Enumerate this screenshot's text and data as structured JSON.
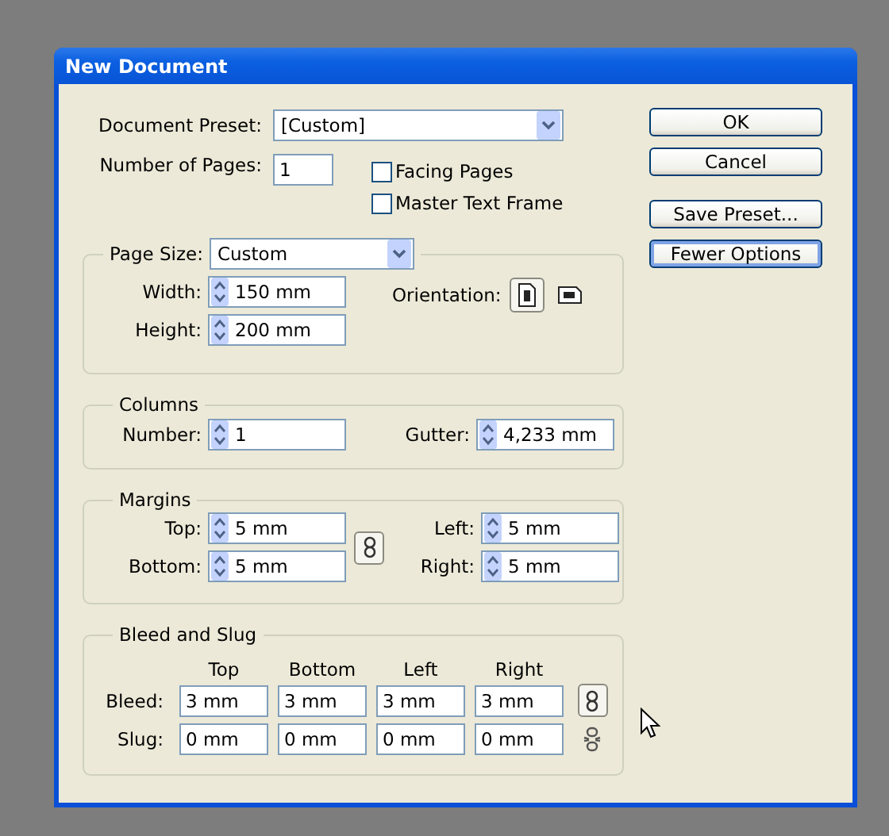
{
  "window": {
    "title": "New Document"
  },
  "document_preset": {
    "label": "Document Preset:",
    "value": "[Custom]"
  },
  "number_of_pages": {
    "label": "Number of Pages:",
    "value": "1"
  },
  "checkboxes": [
    {
      "label": "Facing Pages",
      "checked": false
    },
    {
      "label": "Master Text Frame",
      "checked": false
    }
  ],
  "page_size": {
    "label": "Page Size:",
    "value": "Custom",
    "fields": [
      {
        "label": "Width:",
        "value": "150 mm"
      },
      {
        "label": "Height:",
        "value": "200 mm"
      }
    ],
    "orientation": {
      "label": "Orientation:",
      "options": [
        {
          "kind": "portrait",
          "selected": true
        },
        {
          "kind": "landscape",
          "selected": false
        }
      ]
    }
  },
  "columns": {
    "title": "Columns",
    "fields": [
      {
        "label": "Number:",
        "value": "1"
      },
      {
        "label": "Gutter:",
        "value": "4,233 mm"
      }
    ]
  },
  "margins": {
    "title": "Margins",
    "linked": true,
    "fields": [
      {
        "label": "Top:",
        "value": "5 mm"
      },
      {
        "label": "Left:",
        "value": "5 mm"
      },
      {
        "label": "Bottom:",
        "value": "5 mm"
      },
      {
        "label": "Right:",
        "value": "5 mm"
      }
    ]
  },
  "bleed_slug": {
    "title": "Bleed and Slug",
    "headers": [
      "Top",
      "Bottom",
      "Left",
      "Right"
    ],
    "rows": [
      {
        "label": "Bleed:",
        "linked": true,
        "values": [
          "3 mm",
          "3 mm",
          "3 mm",
          "3 mm"
        ]
      },
      {
        "label": "Slug:",
        "linked": false,
        "values": [
          "0 mm",
          "0 mm",
          "0 mm",
          "0 mm"
        ]
      }
    ]
  },
  "buttons": [
    {
      "label": "OK",
      "focused": false
    },
    {
      "label": "Cancel",
      "focused": false
    },
    {
      "label": "Save Preset...",
      "focused": false
    },
    {
      "label": "Fewer Options",
      "focused": true
    }
  ]
}
